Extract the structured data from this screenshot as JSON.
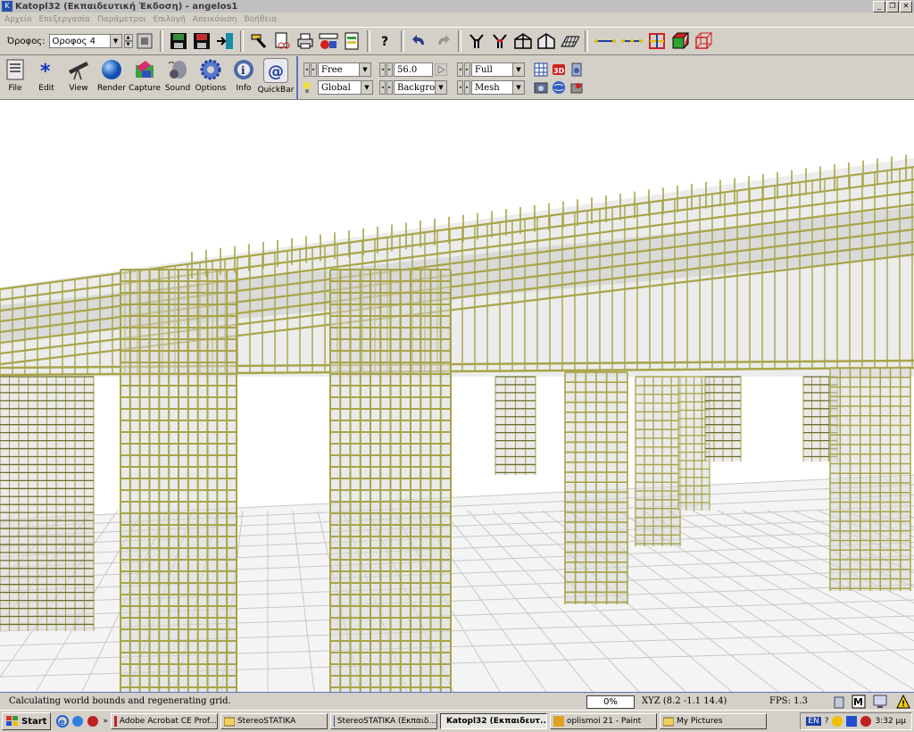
{
  "window": {
    "title": "Katopl32 (Εκπαιδευτική Έκδοση) - angelos1",
    "controls": [
      "_",
      "❐",
      "✕"
    ]
  },
  "menu": [
    "Αρχείο",
    "Επεξεργασία",
    "Παράμετροι",
    "Επιλογή",
    "Απεικόνιση",
    "Βοήθεια"
  ],
  "toolbar1": {
    "floor_label": "Όροφος:",
    "floor_value": "Οροφος 4"
  },
  "toolbar2": {
    "buttons": [
      {
        "label": "File",
        "icon": "file-icon"
      },
      {
        "label": "Edit",
        "icon": "edit-star-icon"
      },
      {
        "label": "View",
        "icon": "telescope-icon"
      },
      {
        "label": "Render",
        "icon": "sphere-icon"
      },
      {
        "label": "Capture",
        "icon": "capture-icon"
      },
      {
        "label": "Sound",
        "icon": "speaker-icon"
      },
      {
        "label": "Options",
        "icon": "gear-icon"
      },
      {
        "label": "Info",
        "icon": "info-icon"
      },
      {
        "label": "QuickBar",
        "icon": "quickbar-icon"
      }
    ],
    "nav_mode": "Free",
    "coord_mode": "Global",
    "fov_value": "56.0",
    "background_label": "Backgro",
    "detail_mode": "Full",
    "render_mode": "Mesh"
  },
  "status": {
    "message": "Calculating world bounds and regenerating grid.",
    "progress": "0%",
    "xyz": "XYZ (8.2 -1.1 14.4)",
    "fps": "FPS: 1.3"
  },
  "taskbar": {
    "start": "Start",
    "tasks": [
      {
        "label": "Adobe Acrobat CE Prof...",
        "active": false
      },
      {
        "label": "StereoSTATIKA",
        "active": false
      },
      {
        "label": "StereoSTATIKA (Εκπαιδ...",
        "active": false
      },
      {
        "label": "Katopl32 (Εκπαιδευτ...",
        "active": true
      },
      {
        "label": "oplismoi 21 - Paint",
        "active": false
      },
      {
        "label": "My Pictures",
        "active": false
      }
    ],
    "lang": "EN",
    "clock": "3:32 μμ"
  },
  "colors": {
    "rebar": "#a8a54a",
    "rebar_dark": "#6e6c2a",
    "concrete": "#d8d8d8",
    "grid": "#c8c8c8",
    "accent": "#6070c0"
  }
}
